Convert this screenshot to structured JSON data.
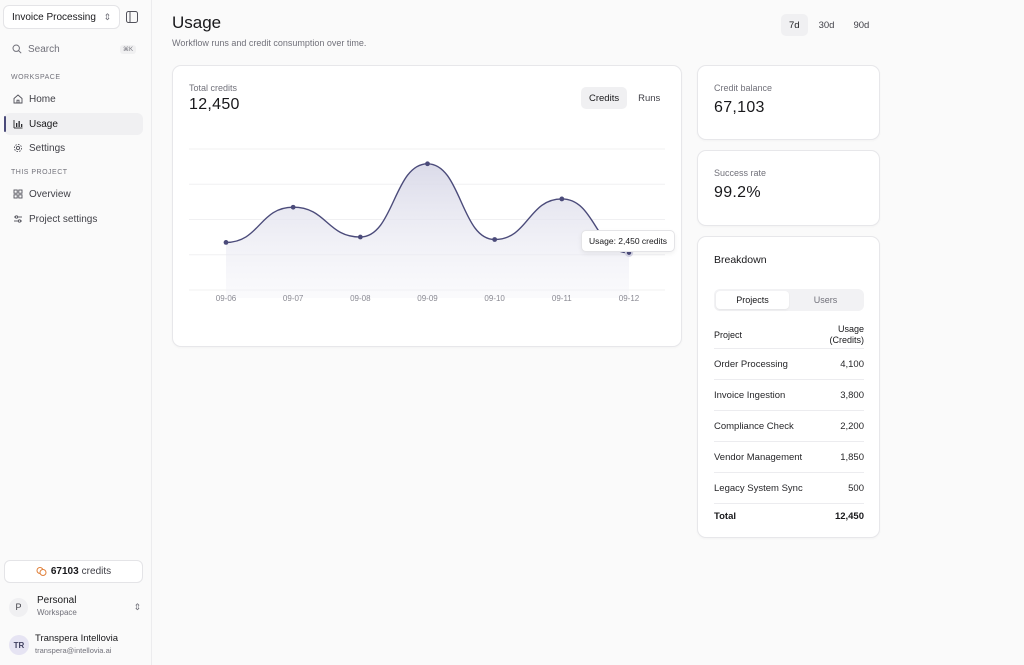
{
  "sidebar": {
    "project_select": "Invoice Processing",
    "search_placeholder": "Search",
    "search_shortcut": "⌘K",
    "workspace_section": "WORKSPACE",
    "workspace_items": [
      {
        "label": "Home",
        "icon": "home-icon"
      },
      {
        "label": "Usage",
        "icon": "bar-chart-icon",
        "active": true
      },
      {
        "label": "Settings",
        "icon": "gear-icon"
      }
    ],
    "project_section": "THIS PROJECT",
    "project_items": [
      {
        "label": "Overview",
        "icon": "grid-icon"
      },
      {
        "label": "Project settings",
        "icon": "sliders-icon"
      }
    ],
    "credits_value": "67103",
    "credits_label": "credits",
    "workspace": {
      "initial": "P",
      "name": "Personal",
      "sub": "Workspace"
    },
    "user": {
      "initials": "TR",
      "name": "Transpera Intellovia",
      "email": "transpera@intellovia.ai"
    }
  },
  "header": {
    "title": "Usage",
    "subtitle": "Workflow runs and credit consumption over time.",
    "ranges": [
      "7d",
      "30d",
      "90d"
    ],
    "active_range": "7d"
  },
  "chart_card": {
    "label": "Total credits",
    "value": "12,450",
    "toggle": [
      "Credits",
      "Runs"
    ],
    "active_toggle": "Credits",
    "tooltip": "Usage: 2,450 credits"
  },
  "chart_data": {
    "type": "area",
    "categories": [
      "09-06",
      "09-07",
      "09-08",
      "09-09",
      "09-10",
      "09-11",
      "09-12"
    ],
    "series": [
      {
        "values": [
          1150,
          2000,
          1280,
          3050,
          1220,
          2200,
          900
        ]
      }
    ],
    "ylim": [
      0,
      3600
    ],
    "grid": true,
    "line_color": "#4b4b7a",
    "fill_color": "#e6e6f0"
  },
  "credit_balance": {
    "label": "Credit balance",
    "value": "67,103"
  },
  "success_rate": {
    "label": "Success rate",
    "value": "99.2%"
  },
  "breakdown": {
    "title": "Breakdown",
    "tabs": [
      "Projects",
      "Users"
    ],
    "active_tab": "Projects",
    "col_project": "Project",
    "col_usage": "Usage (Credits)",
    "rows": [
      {
        "name": "Order Processing",
        "value": "4,100"
      },
      {
        "name": "Invoice Ingestion",
        "value": "3,800"
      },
      {
        "name": "Compliance Check",
        "value": "2,200"
      },
      {
        "name": "Vendor Management",
        "value": "1,850"
      },
      {
        "name": "Legacy System Sync",
        "value": "500"
      }
    ],
    "total_label": "Total",
    "total_value": "12,450"
  }
}
